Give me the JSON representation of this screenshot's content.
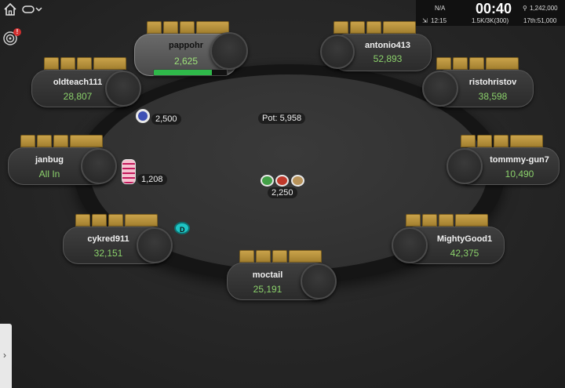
{
  "info": {
    "level_label": "N/A",
    "clock": "00:40",
    "prize": "1,242,000",
    "time": "12:15",
    "blinds": "1.5K/3K(300)",
    "rank": "17th:51,000"
  },
  "pot": "Pot: 5,958",
  "center_bet": "2,250",
  "seats": [
    {
      "name": "pappohr",
      "stack": "2,625"
    },
    {
      "name": "antonio413",
      "stack": "52,893"
    },
    {
      "name": "oldteach111",
      "stack": "28,807"
    },
    {
      "name": "ristohristov",
      "stack": "38,598"
    },
    {
      "name": "janbug",
      "stack": "All In"
    },
    {
      "name": "tommmy-gun7",
      "stack": "10,490"
    },
    {
      "name": "cykred911",
      "stack": "32,151"
    },
    {
      "name": "MightyGood1",
      "stack": "42,375"
    },
    {
      "name": "moctail",
      "stack": "25,191"
    }
  ],
  "bets": {
    "oldteach111": "2,500",
    "janbug": "1,208"
  },
  "badge": "!",
  "timer_bar": 0.8,
  "icons": [
    "home-icon",
    "menu-icon",
    "target-icon",
    "chevron-right-icon",
    "dealer-button-icon"
  ]
}
